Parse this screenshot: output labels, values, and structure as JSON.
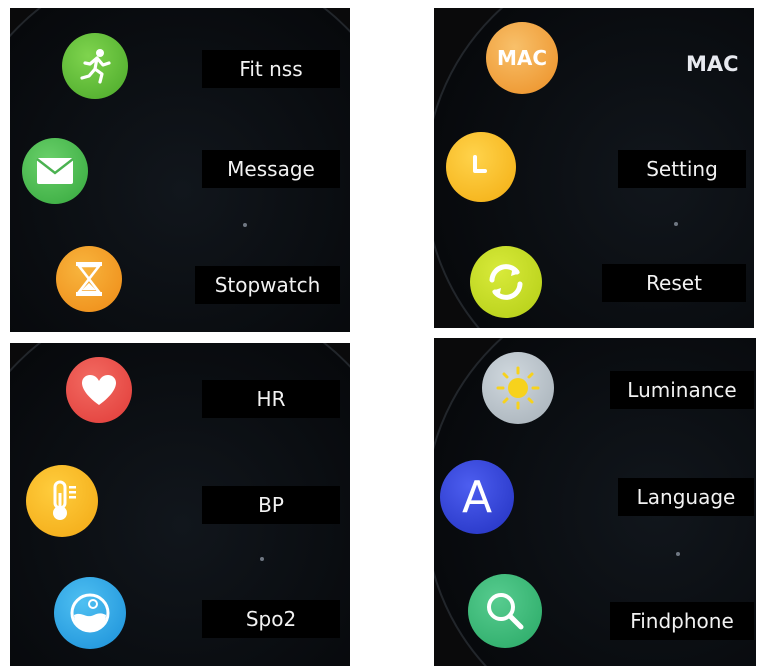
{
  "panels": {
    "top_left": {
      "items": [
        {
          "label": "Fit nss",
          "icon": "running-person-icon",
          "color": "#5bbf35"
        },
        {
          "label": "Message",
          "icon": "envelope-icon",
          "color": "#42b84a"
        },
        {
          "label": "Stopwatch",
          "icon": "hourglass-icon",
          "color": "#f29a21"
        }
      ]
    },
    "top_right": {
      "header": "MAC",
      "items": [
        {
          "label": "MAC",
          "icon": "mac-icon",
          "color": "#f0a13a",
          "icon_text": "MAC"
        },
        {
          "label": "Setting",
          "icon": "clock-icon",
          "color": "#f5b91c"
        },
        {
          "label": "Reset",
          "icon": "refresh-icon",
          "color": "#c6dc1e"
        }
      ]
    },
    "bottom_left": {
      "items": [
        {
          "label": "HR",
          "icon": "heart-icon",
          "color": "#e94d4a"
        },
        {
          "label": "BP",
          "icon": "thermometer-icon",
          "color": "#f3b01b"
        },
        {
          "label": "Spo2",
          "icon": "oxygen-icon",
          "color": "#23a6e8"
        }
      ]
    },
    "bottom_right": {
      "items": [
        {
          "label": "Luminance",
          "icon": "sun-icon",
          "color": "#b7c1c8"
        },
        {
          "label": "Language",
          "icon": "letter-a-icon",
          "color": "#2e3fd3",
          "icon_text": "A"
        },
        {
          "label": "Findphone",
          "icon": "magnifier-icon",
          "color": "#37b87a"
        }
      ]
    }
  }
}
